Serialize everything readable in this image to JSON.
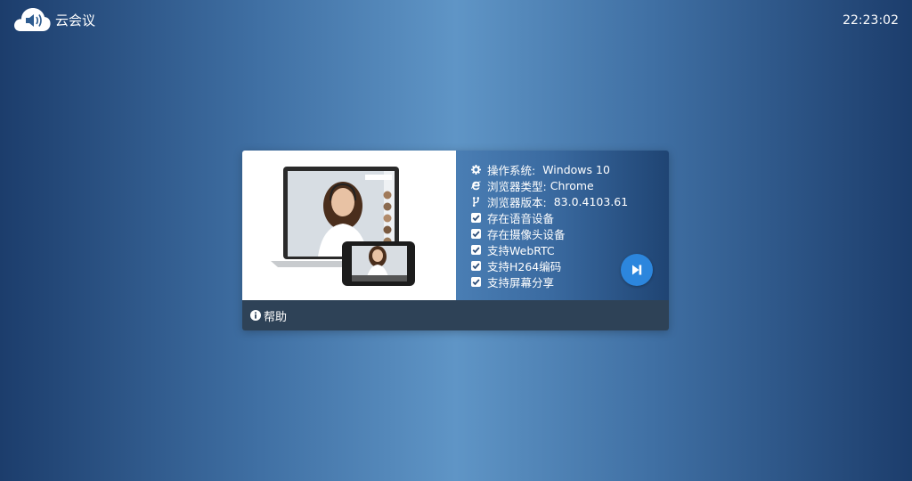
{
  "app": {
    "title": "云会议",
    "clock": "22:23:02"
  },
  "info": {
    "os_label": "操作系统:",
    "os_value": "Windows 10",
    "browser_label": "浏览器类型:",
    "browser_value": "Chrome",
    "version_label": "浏览器版本:",
    "version_value": "83.0.4103.61",
    "checks": [
      "存在语音设备",
      "存在摄像头设备",
      "支持WebRTC",
      "支持H264编码",
      "支持屏幕分享"
    ]
  },
  "help_label": "帮助",
  "icons": {
    "logo": "cloud-speaker-icon",
    "os": "gear-icon",
    "browser": "ie-icon",
    "version": "code-fork-icon",
    "check": "checkbox-checked-icon",
    "next": "step-forward-icon",
    "help": "info-circle-icon"
  },
  "colors": {
    "accent": "#2c86dd",
    "footer": "#2e4257"
  }
}
